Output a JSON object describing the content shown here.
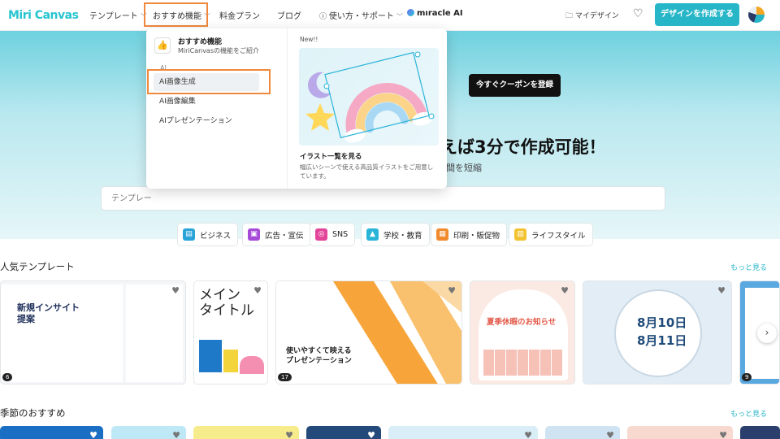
{
  "header": {
    "logo": "Miri Canvas",
    "nav": [
      {
        "label": "テンプレート",
        "chevron": "﹀"
      },
      {
        "label": "おすすめ機能",
        "chevron": "﹀"
      },
      {
        "label": "料金プラン",
        "chevron": ""
      },
      {
        "label": "ブログ",
        "chevron": ""
      },
      {
        "label": "使い方・サポート",
        "chevron": "﹀"
      }
    ],
    "miracle": "mıracle AI",
    "mydesign": "マイデザイン",
    "create_button": "デザインを作成する"
  },
  "dropdown": {
    "head_title": "おすすめ機能",
    "head_sub": "MiriCanvasの機能をご紹介",
    "section_label": "AI",
    "items": [
      "AI画像生成",
      "AI画像編集",
      "AIプレゼンテーション"
    ],
    "new_label": "New!!",
    "art_title": "イラスト一覧を見る",
    "art_sub": "幅広いシーンで使える高品質イラストをご用意しています。"
  },
  "hero": {
    "coupon": "今すぐクーポンを登録",
    "title_tail": "えば3分で作成可能！",
    "sub_tail": "間を短縮",
    "search_placeholder": "テンプレー",
    "categories": [
      {
        "label": "ビジネス",
        "color": "#2aa3d8",
        "icon": "▤"
      },
      {
        "label": "広告・宣伝",
        "color": "#a64ad8",
        "icon": "▣"
      },
      {
        "label": "SNS",
        "color": "#e2459a",
        "icon": "◎"
      },
      {
        "label": "学校・教育",
        "color": "#2ab4d8",
        "icon": "▲"
      },
      {
        "label": "印刷・販促物",
        "color": "#f08a2c",
        "icon": "▦"
      },
      {
        "label": "ライフスタイル",
        "color": "#f2c230",
        "icon": "▥"
      }
    ]
  },
  "popular": {
    "title": "人気テンプレート",
    "more": "もっと見る",
    "cards": [
      {
        "text": "新規インサイト\n提案",
        "badge": "6"
      },
      {
        "text": "メイン\nタイトル",
        "badge": ""
      },
      {
        "text": "使いやすくて映える\nプレゼンテーション",
        "badge": "17"
      },
      {
        "text": "夏季休暇のお知らせ",
        "badge": ""
      },
      {
        "text": "8月10日\n8月11日",
        "badge": ""
      },
      {
        "text": "",
        "badge": "9"
      }
    ]
  },
  "seasonal": {
    "title": "季節のおすすめ",
    "more": "もっと見る"
  },
  "colors": {
    "accent": "#27b6c8",
    "highlight": "#f0893d"
  }
}
